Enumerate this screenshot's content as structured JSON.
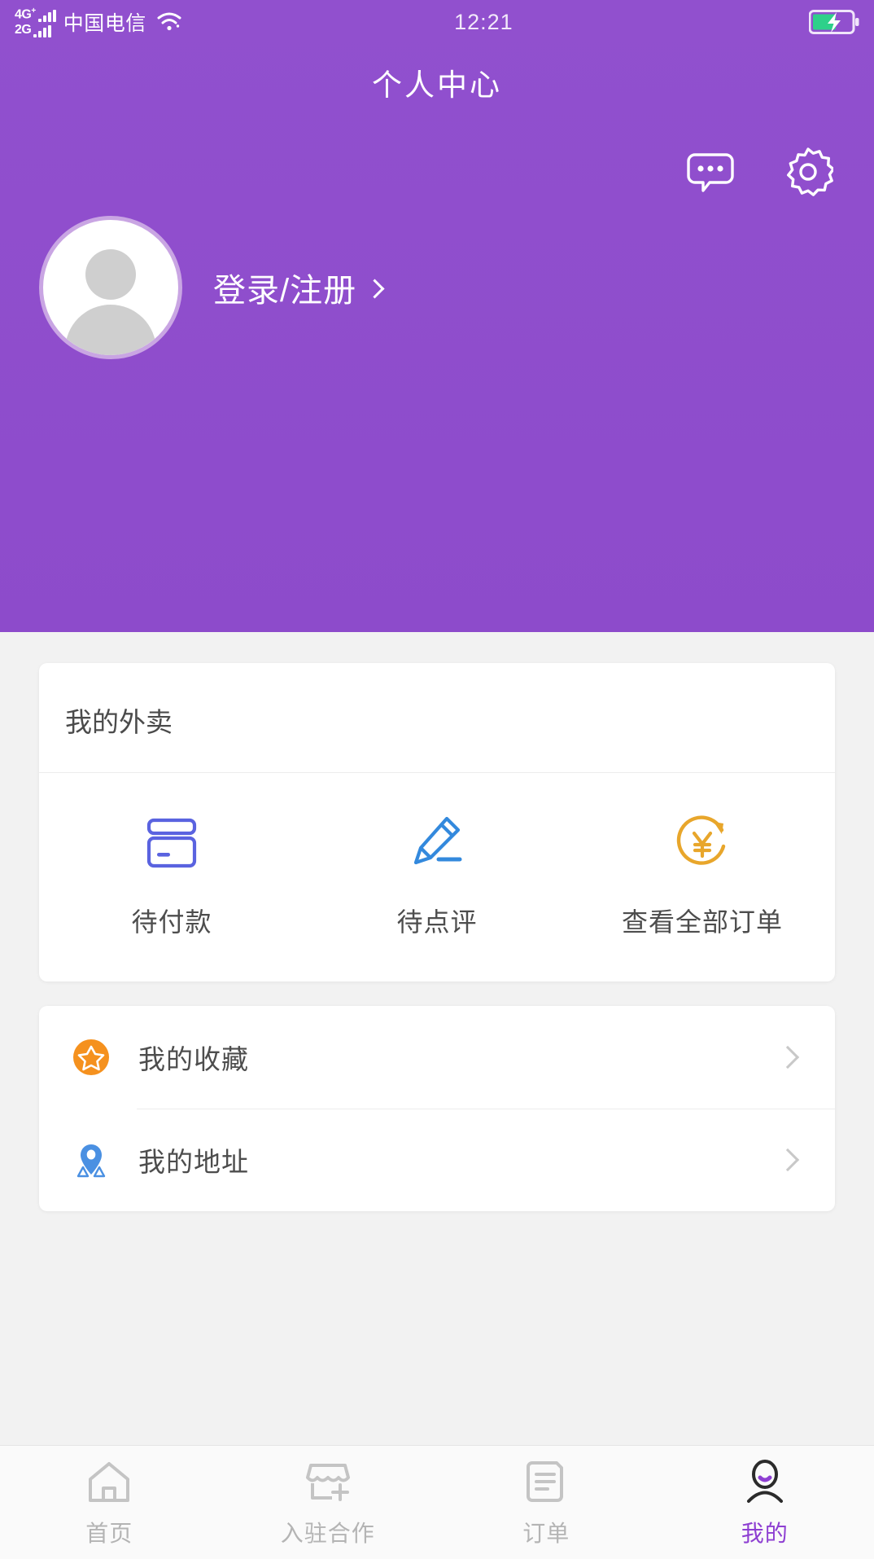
{
  "statusbar": {
    "sim1_label": "4G",
    "sim1_sup": "+",
    "sim2_label": "2G",
    "carrier": "中国电信",
    "wifi_icon": "wifi-icon",
    "time": "12:21",
    "battery_icon": "battery-charging-icon",
    "battery_level_percent": 55
  },
  "header": {
    "title": "个人中心",
    "accent_color": "#8e4fce",
    "message_icon": "chat-bubble-icon",
    "settings_icon": "gear-icon",
    "avatar_icon": "default-avatar-icon",
    "login_label": "登录/注册",
    "login_chevron_icon": "chevron-right-icon"
  },
  "takeout_card": {
    "title": "我的外卖",
    "items": [
      {
        "label": "待付款",
        "icon": "credit-card-icon",
        "color": "#5a63e0"
      },
      {
        "label": "待点评",
        "icon": "pencil-edit-icon",
        "color": "#3389dd"
      },
      {
        "label": "查看全部订单",
        "icon": "yuan-refresh-icon",
        "color": "#e8a62b"
      }
    ]
  },
  "links_card": {
    "items": [
      {
        "label": "我的收藏",
        "icon": "star-favorite-icon",
        "color": "#f5911e",
        "chevron": "chevron-right-icon"
      },
      {
        "label": "我的地址",
        "icon": "location-pin-icon",
        "color": "#4a90e2",
        "chevron": "chevron-right-icon"
      }
    ]
  },
  "tabbar": {
    "active_color": "#8e3fd2",
    "inactive_color": "#b4b4b4",
    "tabs": [
      {
        "label": "首页",
        "icon": "home-icon",
        "active": false
      },
      {
        "label": "入驻合作",
        "icon": "shop-add-icon",
        "active": false
      },
      {
        "label": "订单",
        "icon": "order-list-icon",
        "active": false
      },
      {
        "label": "我的",
        "icon": "person-icon",
        "active": true
      }
    ]
  }
}
